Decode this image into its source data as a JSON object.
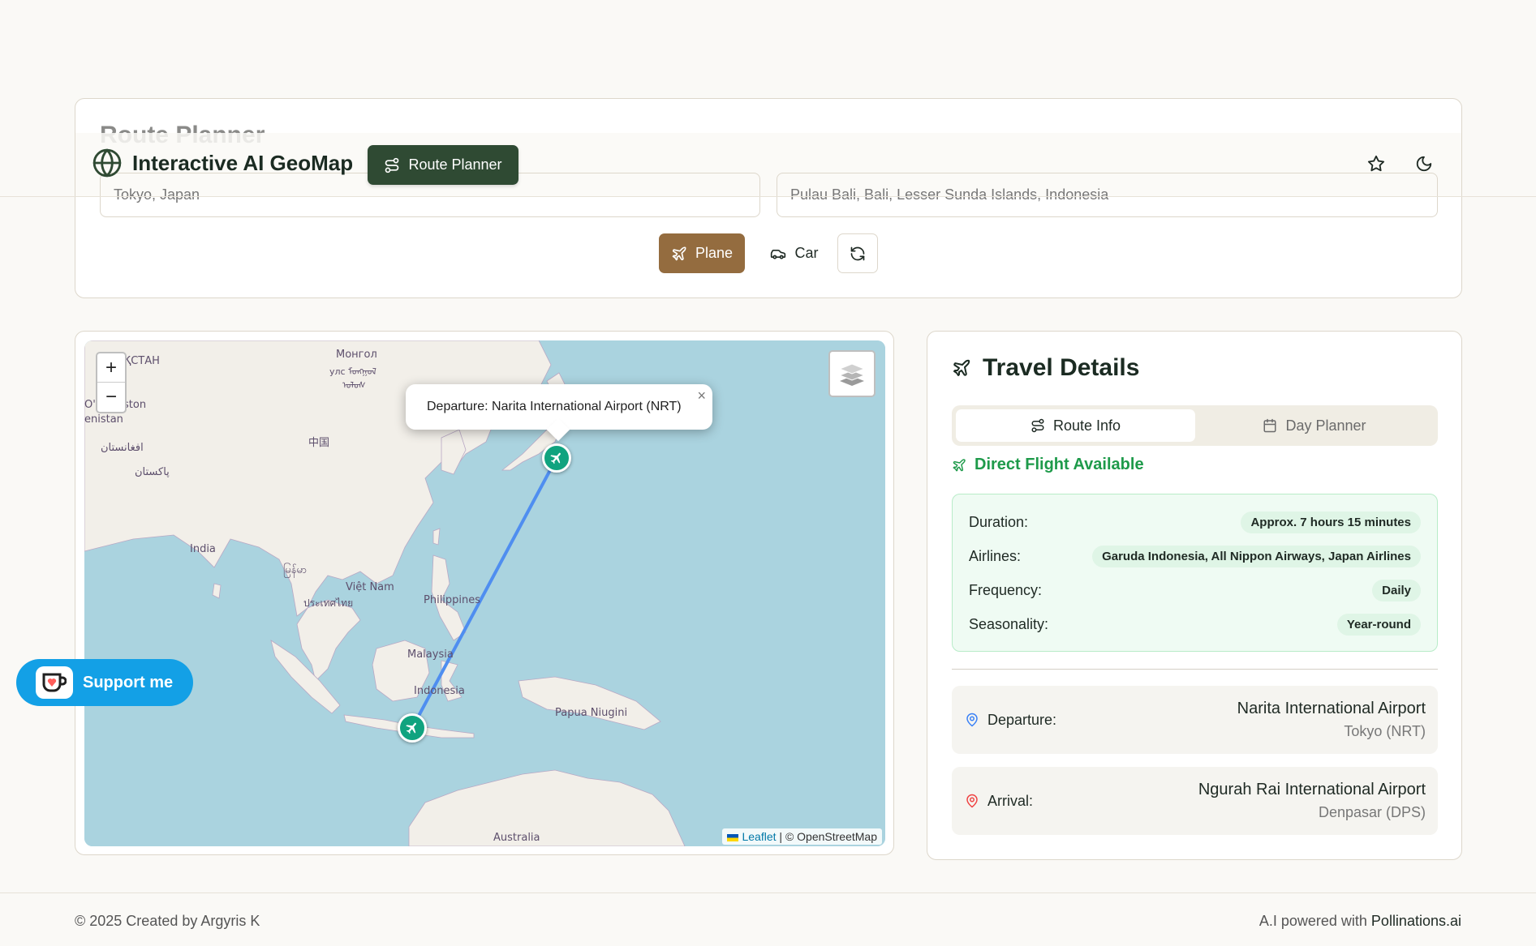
{
  "header": {
    "brand": "Interactive AI GeoMap",
    "nav_route_planner": "Route Planner",
    "favorites_icon": "star-icon",
    "theme_icon": "moon-icon"
  },
  "planner": {
    "title": "Route Planner",
    "from_value": "Tokyo, Japan",
    "to_value": "Pulau Bali, Bali, Lesser Sunda Islands, Indonesia",
    "mode_plane": "Plane",
    "mode_car": "Car",
    "selected_mode": "Plane",
    "accent_color": "#946c3f"
  },
  "map": {
    "zoom_in": "+",
    "zoom_out": "−",
    "popup_text": "Departure: Narita International Airport (NRT)",
    "popup_close": "×",
    "attribution_link": "Leaflet",
    "attribution_text": "| © OpenStreetMap",
    "labels": {
      "kz": "ҚСТАН",
      "mongolia1": "Монгол",
      "mongolia2": "улс ᠮᠣᠩᠭᠣᠯ",
      "mongolia3": "ᠤᠯᠤᠰ",
      "uzb": "O'zbekiston",
      "tjk": "enistan",
      "china": "中国",
      "afg": "افغانستان",
      "pak": "پاکستان",
      "india": "India",
      "myanmar": "မြန်မာ",
      "vietnam": "Việt Nam",
      "thai": "ประเทศไทย",
      "phil": "Philippines",
      "malaysia": "Malaysia",
      "indonesia": "Indonesia",
      "png": "Papua Niugini",
      "australia": "Australia"
    }
  },
  "support": {
    "label": "Support me"
  },
  "details": {
    "title": "Travel Details",
    "tab_route": "Route Info",
    "tab_day": "Day Planner",
    "active_tab": "Route Info",
    "direct": "Direct Flight Available",
    "rows": [
      {
        "k": "Duration:",
        "v": "Approx. 7 hours 15 minutes"
      },
      {
        "k": "Airlines:",
        "v": "Garuda Indonesia, All Nippon Airways, Japan Airlines"
      },
      {
        "k": "Frequency:",
        "v": "Daily"
      },
      {
        "k": "Seasonality:",
        "v": "Year-round"
      }
    ],
    "departure": {
      "label": "Departure:",
      "name": "Narita International Airport",
      "sub": "Tokyo (NRT)",
      "color": "#3b82f6"
    },
    "arrival": {
      "label": "Arrival:",
      "name": "Ngurah Rai International Airport",
      "sub": "Denpasar (DPS)",
      "color": "#ef4444"
    }
  },
  "footer": {
    "left": "© 2025 Created by Argyris K",
    "right_prefix": "A.I powered with",
    "right_brand": "Pollinations.ai"
  }
}
